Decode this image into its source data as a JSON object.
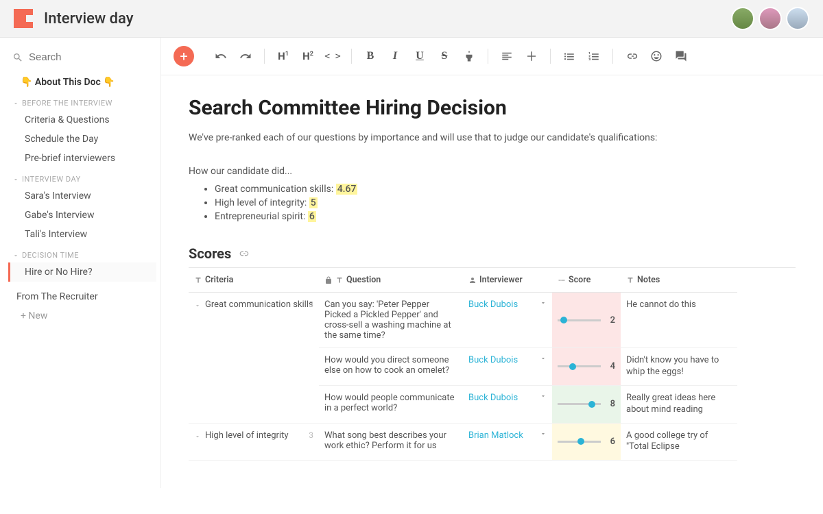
{
  "header": {
    "doc_title": "Interview day"
  },
  "sidebar": {
    "search_placeholder": "Search",
    "about": "About This Doc",
    "sections": [
      {
        "title": "BEFORE THE INTERVIEW",
        "items": [
          "Criteria & Questions",
          "Schedule the Day",
          "Pre-brief interviewers"
        ]
      },
      {
        "title": "INTERVIEW DAY",
        "items": [
          "Sara's Interview",
          "Gabe's Interview",
          "Tali's Interview"
        ]
      },
      {
        "title": "DECISION TIME",
        "items": [
          "Hire or No Hire?"
        ]
      }
    ],
    "footer_item": "From The Recruiter",
    "new_label": "New"
  },
  "doc": {
    "title": "Search Committee Hiring Decision",
    "intro": "We've pre-ranked each of our questions by importance and will use that to judge our candidate's qualifications:",
    "how_did": "How our candidate did...",
    "bullets": [
      {
        "label": "Great communication skills:",
        "value": "4.67"
      },
      {
        "label": "High level of integrity:",
        "value": "5"
      },
      {
        "label": "Entrepreneurial spirit:",
        "value": "6"
      }
    ],
    "scores_heading": "Scores",
    "columns": {
      "criteria": "Criteria",
      "question": "Question",
      "interviewer": "Interviewer",
      "score": "Score",
      "notes": "Notes"
    },
    "groups": [
      {
        "criteria": "Great communication skills",
        "count": "3",
        "rows": [
          {
            "question": "Can you say: 'Peter Pepper Picked a Pickled Pepper' and cross-sell a washing machine at the same time?",
            "interviewer": "Buck Dubois",
            "score": "2",
            "tone": "bad",
            "slider_pct": 15,
            "notes": "He cannot do this"
          },
          {
            "question": "How would you direct someone else on how to cook an omelet?",
            "interviewer": "Buck Dubois",
            "score": "4",
            "tone": "bad",
            "slider_pct": 35,
            "notes": "Didn't know you have to whip the eggs!"
          },
          {
            "question": "How would people communicate in a perfect world?",
            "interviewer": "Buck Dubois",
            "score": "8",
            "tone": "good",
            "slider_pct": 80,
            "notes": "Really great ideas here about mind reading"
          }
        ]
      },
      {
        "criteria": "High level of integrity",
        "count": "3",
        "rows": [
          {
            "question": "What song best describes your work ethic? Perform it for us",
            "interviewer": "Brian Matlock",
            "score": "6",
            "tone": "mid",
            "slider_pct": 55,
            "notes": "A good college try of \"Total Eclipse"
          }
        ]
      }
    ]
  }
}
